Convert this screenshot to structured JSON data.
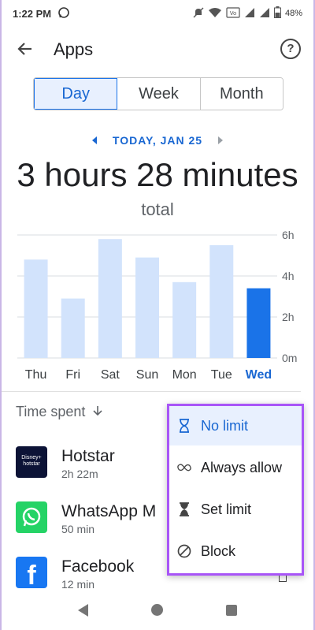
{
  "status_bar": {
    "time": "1:22 PM",
    "battery": "48%"
  },
  "app_bar": {
    "title": "Apps"
  },
  "tabs": [
    {
      "label": "Day",
      "active": true
    },
    {
      "label": "Week",
      "active": false
    },
    {
      "label": "Month",
      "active": false
    }
  ],
  "date_nav": {
    "label": "TODAY, JAN 25"
  },
  "summary": {
    "total_time": "3 hours 28 minutes",
    "total_label": "total"
  },
  "chart_data": {
    "type": "bar",
    "categories": [
      "Thu",
      "Fri",
      "Sat",
      "Sun",
      "Mon",
      "Tue",
      "Wed"
    ],
    "values": [
      4.8,
      2.9,
      5.8,
      4.9,
      3.7,
      5.5,
      3.4
    ],
    "unit": "h",
    "ylim": [
      0,
      6
    ],
    "y_ticks": [
      "0m",
      "2h",
      "4h",
      "6h"
    ],
    "grid": true,
    "highlighted_index": 6,
    "colors": {
      "bar": "#d2e3fc",
      "highlight": "#1a73e8"
    }
  },
  "sort": {
    "label": "Time spent"
  },
  "apps": [
    {
      "name": "Hotstar",
      "time": "2h 22m",
      "icon": "hotstar-icon",
      "icon_text": "Disney+ hotstar"
    },
    {
      "name": "WhatsApp M",
      "time": "50 min",
      "icon": "whatsapp-icon"
    },
    {
      "name": "Facebook",
      "time": "12 min",
      "icon": "facebook-icon",
      "icon_text": "f"
    }
  ],
  "dropdown": {
    "items": [
      {
        "label": "No limit",
        "icon": "hourglass-outline-icon",
        "selected": true
      },
      {
        "label": "Always allow",
        "icon": "infinity-icon",
        "selected": false
      },
      {
        "label": "Set limit",
        "icon": "hourglass-icon",
        "selected": false
      },
      {
        "label": "Block",
        "icon": "block-icon",
        "selected": false
      }
    ],
    "border_color": "#a855f7"
  },
  "colors": {
    "accent": "#1a73e8",
    "accent_text": "#1967d2"
  }
}
